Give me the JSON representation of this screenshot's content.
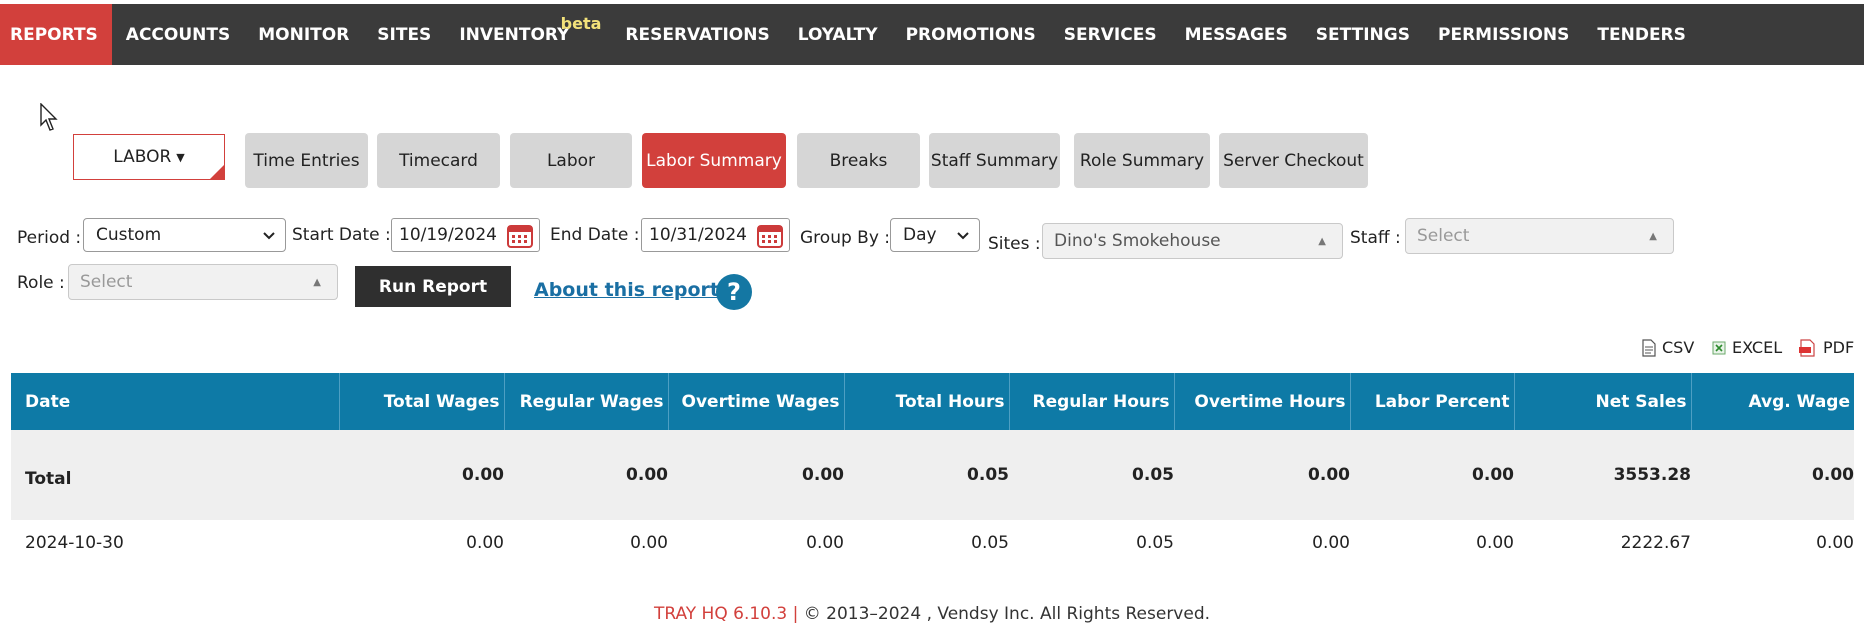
{
  "nav": {
    "items": [
      {
        "label": "REPORTS",
        "active": true
      },
      {
        "label": "ACCOUNTS"
      },
      {
        "label": "MONITOR"
      },
      {
        "label": "SITES"
      },
      {
        "label": "INVENTORY",
        "badge": "beta"
      },
      {
        "label": "RESERVATIONS"
      },
      {
        "label": "LOYALTY"
      },
      {
        "label": "PROMOTIONS"
      },
      {
        "label": "SERVICES"
      },
      {
        "label": "MESSAGES"
      },
      {
        "label": "SETTINGS"
      },
      {
        "label": "PERMISSIONS"
      },
      {
        "label": "TENDERS"
      }
    ]
  },
  "category": {
    "label": "LABOR"
  },
  "report_tabs": [
    {
      "label": "Time Entries"
    },
    {
      "label": "Timecard"
    },
    {
      "label": "Labor"
    },
    {
      "label": "Labor Summary",
      "active": true
    },
    {
      "label": "Breaks"
    },
    {
      "label": "Staff Summary"
    },
    {
      "label": "Role Summary"
    },
    {
      "label": "Server Checkout"
    }
  ],
  "filters": {
    "period_label": "Period :",
    "period_value": "Custom",
    "start_label": "Start Date :",
    "start_value": "10/19/2024",
    "end_label": "End Date :",
    "end_value": "10/31/2024",
    "groupby_label": "Group By :",
    "groupby_value": "Day",
    "sites_label": "Sites :",
    "sites_value": "Dino's Smokehouse",
    "staff_label": "Staff :",
    "staff_placeholder": "Select",
    "role_label": "Role :",
    "role_placeholder": "Select"
  },
  "actions": {
    "run_label": "Run Report",
    "about_label": "About this report",
    "help_glyph": "?"
  },
  "exports": {
    "csv": "CSV",
    "excel": "EXCEL",
    "pdf": "PDF"
  },
  "table": {
    "columns": [
      "Date",
      "Total Wages",
      "Regular Wages",
      "Overtime Wages",
      "Total Hours",
      "Regular Hours",
      "Overtime Hours",
      "Labor Percent",
      "Net Sales",
      "Avg. Wage"
    ],
    "total": [
      "Total",
      "0.00",
      "0.00",
      "0.00",
      "0.05",
      "0.05",
      "0.00",
      "0.00",
      "3553.28",
      "0.00"
    ],
    "rows": [
      [
        "2024-10-30",
        "0.00",
        "0.00",
        "0.00",
        "0.05",
        "0.05",
        "0.00",
        "0.00",
        "2222.67",
        "0.00"
      ]
    ]
  },
  "footer": {
    "version": "TRAY HQ 6.10.3 |",
    "copyright": "© 2013–2024 , Vendsy Inc. All Rights Reserved."
  },
  "colors": {
    "accent": "#d2403c",
    "header": "#0e7aa6",
    "nav": "#3b3b3b"
  },
  "icons": [
    "mouse-pointer-icon",
    "calendar-icon",
    "chevron-down-icon",
    "help-icon",
    "csv-file-icon",
    "excel-file-icon",
    "pdf-file-icon"
  ]
}
